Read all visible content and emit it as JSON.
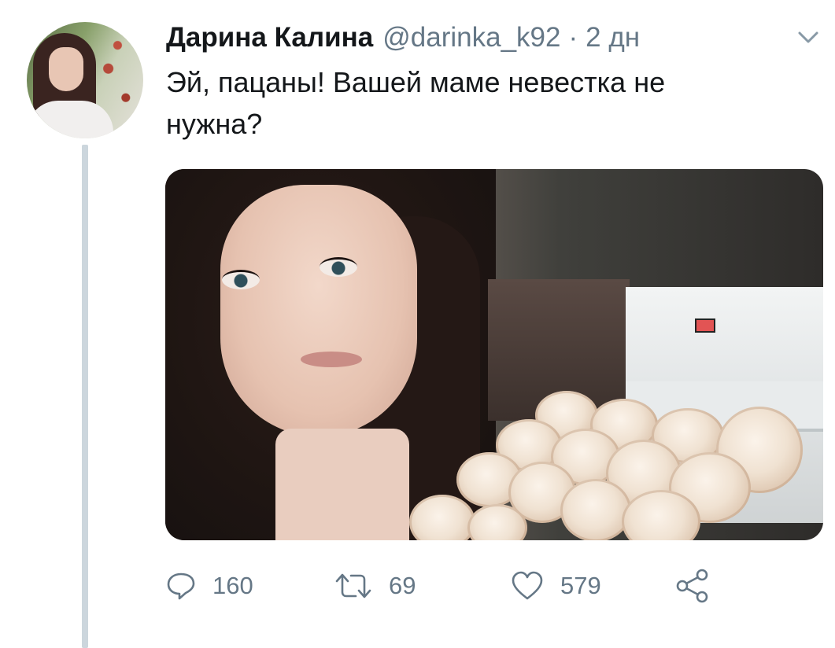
{
  "tweet": {
    "author_name": "Дарина Калина",
    "author_handle": "@darinka_k92",
    "separator": "·",
    "timestamp": "2 дн",
    "text": "Эй, пацаны! Вашей маме невестка не нужна?",
    "actions": {
      "replies": "160",
      "retweets": "69",
      "likes": "579"
    }
  },
  "colors": {
    "text_primary": "#14171a",
    "text_secondary": "#657786",
    "thread_line": "#ccd6dd"
  },
  "icons": {
    "menu": "chevron-down-icon",
    "reply": "reply-icon",
    "retweet": "retweet-icon",
    "like": "heart-icon",
    "share": "share-icon"
  }
}
